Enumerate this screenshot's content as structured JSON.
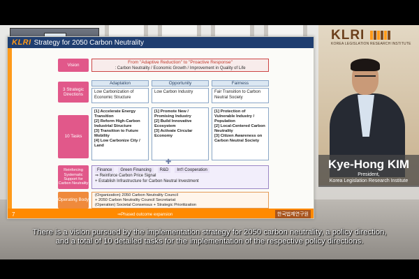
{
  "slide": {
    "brand": "KLRI",
    "title": "Strategy for 2050 Carbon Neutrality",
    "page_number": "7",
    "footer_logo": "한국법제연구원",
    "vision": {
      "label": "Vision",
      "line1": "From \"Adaptive Reduction\" to \"Proactive Response\"",
      "line2": ": Carbon Neutrality / Economic Growth / Improvement in Quality of Life"
    },
    "directions": {
      "label": "3 Strategic Directions",
      "headers": [
        "Adaptation",
        "Opportunity",
        "Fairness"
      ],
      "cells": [
        "Low Carbonization of Economic Structure",
        "Low Carbon Industry",
        "Fair Transition to Carbon Neutral Society"
      ]
    },
    "tasks": {
      "label": "10 Tasks",
      "columns": [
        [
          "[1] Accelerate Energy Transition",
          "[2] Reform High-Carbon Industrial Structure",
          "[3] Transition to Future Mobility",
          "[4] Low Carbonize City / Land"
        ],
        [
          "[1] Promote New / Promising Industry",
          "[2] Build Innovative Ecosystem",
          "[3] Activate Circular Economy"
        ],
        [
          "[1] Protection of Vulnerable Industry / Population",
          "[2] Local-Centered Carbon Neutrality",
          "[3] Citizen Awareness on Carbon Neutral Society"
        ]
      ]
    },
    "support": {
      "label": "Reinforcing Systematic Support for Carbon Neutrality",
      "chips": [
        "Finance",
        "Green Financing",
        "R&D",
        "Int'l Cooperation"
      ],
      "line1": "⇒ Reinforce Carbon Price Signal",
      "line2": "+ Establish Infrastructure for Carbon Neutral Investment"
    },
    "operating": {
      "label": "Operating Body",
      "line1": "(Organization) 2050 Carbon Neutrality Council",
      "line2": "+ 2050 Carbon Neutrality Council Secretariat",
      "line3": "(Operation) Societal Consensus + Strategic Prioritization",
      "line4": "⇒Phased outcome expansion"
    }
  },
  "logo": {
    "wordmark": "KLRI",
    "subtitle": "KOREA LEGISLATION RESEARCH INSTITUTE"
  },
  "speaker": {
    "name": "Kye-Hong KIM",
    "role_line1": "President,",
    "role_line2": "Korea Legislation Research Institute"
  },
  "caption": {
    "line1": "There is a vision pursued by the implementation strategy for 2050 carbon neutrality, a policy direction,",
    "line2": "and a total of 10 detailed tasks for the implementation of the respective policy directions."
  }
}
